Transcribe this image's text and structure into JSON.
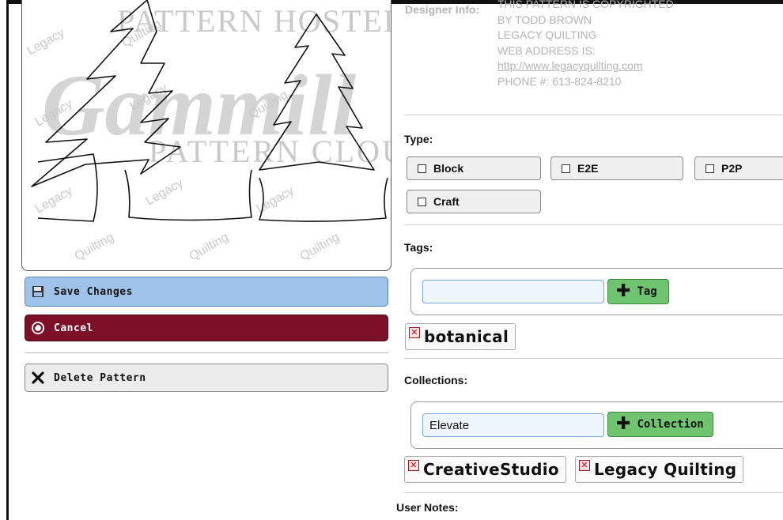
{
  "preview": {
    "watermark_top": "PATTERN HOSTED BY",
    "watermark_brand": "Gammill",
    "watermark_bottom": "PATTERN CLOUD",
    "tile_word_1": "Legacy",
    "tile_word_2": "Quilting"
  },
  "actions": {
    "save_label": "Save Changes",
    "cancel_label": "Cancel",
    "delete_label": "Delete Pattern"
  },
  "designer": {
    "label": "Designer Info:",
    "lines": [
      "THIS PATTERN IS COPYRIGHTED",
      "BY TODD BROWN",
      "LEGACY QUILTING",
      "WEB ADDRESS IS:"
    ],
    "link": "http://www.legacyquilting.com",
    "phone": "PHONE #: 613-824-8210"
  },
  "type": {
    "label": "Type:",
    "options": [
      "Block",
      "E2E",
      "P2P",
      "Craft"
    ]
  },
  "tags": {
    "label": "Tags:",
    "input_value": "",
    "add_label": "Tag",
    "items": [
      "botanical"
    ]
  },
  "collections": {
    "label": "Collections:",
    "input_value": "Elevate",
    "add_label": "Collection",
    "items": [
      "CreativeStudio",
      "Legacy Quilting"
    ]
  },
  "notes": {
    "label": "User Notes:"
  },
  "icons": {
    "save": "floppy-disk-icon",
    "cancel": "undo-circle-icon",
    "delete": "x-icon",
    "add": "plus-icon",
    "remove": "remove-x-icon"
  },
  "colors": {
    "save_bg": "#9fc3e8",
    "cancel_bg": "#7c1029",
    "add_bg": "#6fc46f",
    "link": "#b4b4b4"
  }
}
